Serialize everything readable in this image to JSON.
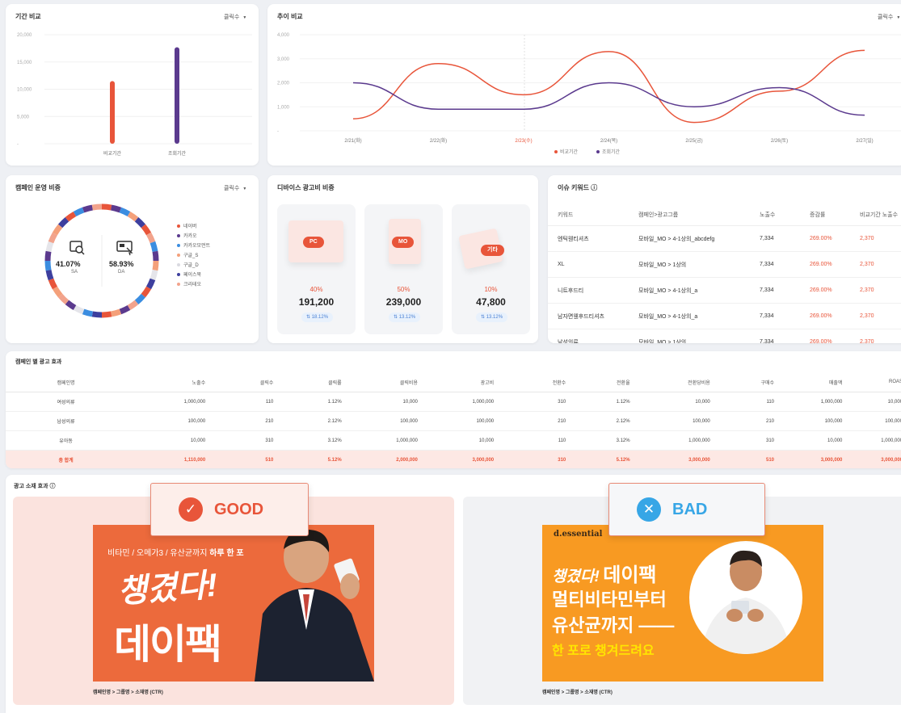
{
  "period_compare": {
    "title": "기간 비교",
    "metric": "클릭수",
    "y_ticks": [
      "20,000",
      "15,000",
      "10,000",
      "5,000",
      "-"
    ],
    "bars": [
      {
        "label": "비교기간",
        "value": 11500,
        "color": "#e8553a"
      },
      {
        "label": "조회기간",
        "value": 17700,
        "color": "#5b3a8e"
      }
    ]
  },
  "trend_compare": {
    "title": "추이 비교",
    "metric": "클릭수",
    "y_ticks": [
      "4,000",
      "3,000",
      "2,000",
      "1,000",
      "-"
    ],
    "x_labels": [
      "2/21(화)",
      "2/22(화)",
      "2/23(수)",
      "2/24(목)",
      "2/25(금)",
      "2/26(토)",
      "2/27(일)"
    ],
    "legend": [
      "비교기간",
      "조회기간"
    ]
  },
  "chart_data": [
    {
      "type": "bar",
      "title": "기간 비교",
      "categories": [
        "비교기간",
        "조회기간"
      ],
      "values": [
        11500,
        17700
      ],
      "ylim": [
        0,
        20000
      ]
    },
    {
      "type": "line",
      "title": "추이 비교",
      "x": [
        "2/21(화)",
        "2/22(화)",
        "2/23(수)",
        "2/24(목)",
        "2/25(금)",
        "2/26(토)",
        "2/27(일)"
      ],
      "series": [
        {
          "name": "비교기간",
          "color": "#e8553a",
          "values": [
            500,
            2800,
            1500,
            3300,
            350,
            1650,
            3350
          ]
        },
        {
          "name": "조회기간",
          "color": "#5b3a8e",
          "values": [
            2000,
            900,
            900,
            2000,
            1000,
            1800,
            650
          ]
        }
      ],
      "ylim": [
        0,
        4000
      ]
    }
  ],
  "campaign_share": {
    "title": "캠페인 운영 비중",
    "metric": "클릭수",
    "sa": {
      "pct": "41.07%",
      "label": "SA"
    },
    "da": {
      "pct": "58.93%",
      "label": "DA"
    },
    "legend": [
      {
        "label": "네이버",
        "color": "#e8553a"
      },
      {
        "label": "카카오",
        "color": "#5b3a8e"
      },
      {
        "label": "카카오모먼트",
        "color": "#3b8de0"
      },
      {
        "label": "구글_S",
        "color": "#f4a07a"
      },
      {
        "label": "구글_D",
        "color": "#e5e5ea"
      },
      {
        "label": "페이스북",
        "color": "#3d3f9e"
      },
      {
        "label": "크리테오",
        "color": "#f2a38c"
      }
    ]
  },
  "device_share": {
    "title": "디바이스 광고비 비중",
    "devices": [
      {
        "tag": "PC",
        "pct": "40%",
        "value": "191,200",
        "change": "18.12%"
      },
      {
        "tag": "MO",
        "pct": "50%",
        "value": "239,000",
        "change": "13.12%"
      },
      {
        "tag": "기타",
        "pct": "10%",
        "value": "47,800",
        "change": "13.12%"
      }
    ]
  },
  "issue_keywords": {
    "title": "이슈 키워드 ⓘ",
    "headers": [
      "키워드",
      "캠페인>광고그룹",
      "노출수",
      "증감률",
      "비교기간 노출수"
    ],
    "rows": [
      [
        "엔틱웬티셔츠",
        "모바일_MO > 4-1상의_abcdefg",
        "7,334",
        "269.00%",
        "2,370"
      ],
      [
        "XL",
        "모바일_MO > 1상의",
        "7,334",
        "269.00%",
        "2,370"
      ],
      [
        "니트후드티",
        "모바일_MO > 4-1상의_a",
        "7,334",
        "269.00%",
        "2,370"
      ],
      [
        "남자면웬후드티셔츠",
        "모바일_MO > 4-1상의_a",
        "7,334",
        "269.00%",
        "2,370"
      ],
      [
        "남성의류",
        "모바일_MO > 1상의",
        "7,334",
        "269.00%",
        "2,370"
      ]
    ]
  },
  "campaign_effect": {
    "title": "캠페인 별 광고 효과",
    "headers": [
      "캠페인명",
      "노출수",
      "클릭수",
      "클릭률",
      "클릭비용",
      "광고비",
      "전환수",
      "전환율",
      "전환당비용",
      "구매수",
      "매출액",
      "ROAS"
    ],
    "rows": [
      [
        "여성의류",
        "1,000,000",
        "110",
        "1.12%",
        "10,000",
        "1,000,000",
        "310",
        "1.12%",
        "10,000",
        "110",
        "1,000,000",
        "10,000"
      ],
      [
        "남성의류",
        "100,000",
        "210",
        "2.12%",
        "100,000",
        "100,000",
        "210",
        "2.12%",
        "100,000",
        "210",
        "100,000",
        "100,000"
      ],
      [
        "유아동",
        "10,000",
        "310",
        "3.12%",
        "1,000,000",
        "10,000",
        "110",
        "3.12%",
        "1,000,000",
        "310",
        "10,000",
        "1,000,000"
      ]
    ],
    "total": [
      "총 합계",
      "1,110,000",
      "510",
      "5.12%",
      "2,000,000",
      "3,000,000",
      "310",
      "5.12%",
      "3,000,000",
      "510",
      "3,000,000",
      "3,000,000"
    ]
  },
  "creative": {
    "title": "광고 소재 효과 ⓘ",
    "good": {
      "label": "GOOD",
      "banner_top": "비타민 / 오메가3 / 유산균까지",
      "banner_top_strong": "하루 한 포",
      "headline": "챙겼다!",
      "brand": "데이팩",
      "caption": "캠페인명 > 그룹명 > 소재명 (CTR)"
    },
    "bad": {
      "label": "BAD",
      "brand_logo": "d.essential",
      "line1a": "챙겼다!",
      "line1b": "데이팩",
      "line2": "멀티비타민부터",
      "line3": "유산균까지 ——",
      "line4": "한 포로 챙겨드려요",
      "caption": "캠페인명 > 그룹명 > 소재명 (CTR)"
    }
  }
}
